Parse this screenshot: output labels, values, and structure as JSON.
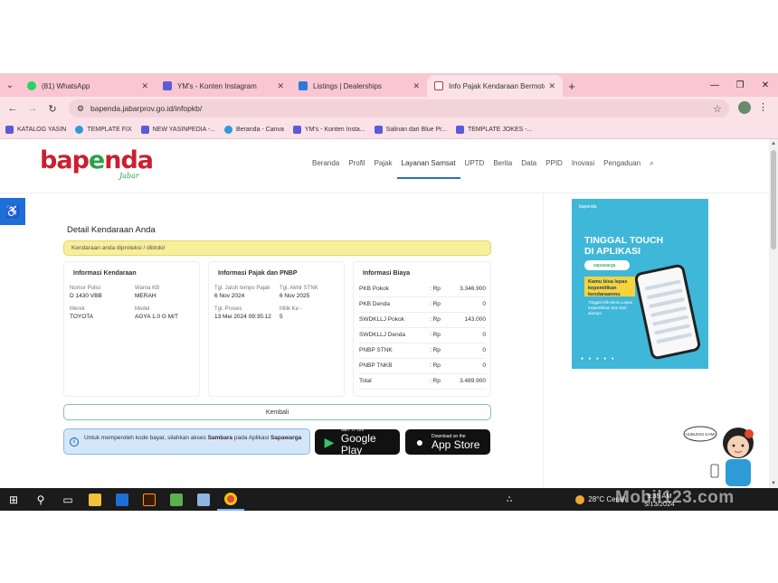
{
  "browser": {
    "tabs": [
      {
        "title": "(81) WhatsApp",
        "favicon_color": "#25d366"
      },
      {
        "title": "YM's - Konten Instagram",
        "favicon_color": "#5b5bd6"
      },
      {
        "title": "Listings | Dealerships",
        "favicon_color": "#2b79d6"
      },
      {
        "title": "Info Pajak Kendaraan Bermotor",
        "favicon_color": "#d03030"
      }
    ],
    "url": "bapenda.jabarprov.go.id/infopkb/",
    "bookmarks": [
      "KATALOG YASIN",
      "TEMPLATE FIX",
      "NEW YASINPEDIA -...",
      "Beranda - Canva",
      "YM's - Konten Insta...",
      "Salinan dari Blue Pr...",
      "TEMPLATE JOKES -..."
    ]
  },
  "site": {
    "logo_main": "bapenda",
    "logo_sub": "Jabar",
    "nav": [
      "Beranda",
      "Profil",
      "Pajak",
      "Layanan Samsat",
      "UPTD",
      "Berita",
      "Data",
      "PPID",
      "Inovasi",
      "Pengaduan"
    ],
    "nav_active": "Layanan Samsat"
  },
  "main": {
    "title": "Detail Kendaraan Anda",
    "notice": "Kendaraan anda diproteksi / diblokir",
    "vehicle": {
      "heading": "Informasi Kendaraan",
      "nopol_label": "Nomor Polisi",
      "nopol": "D 1430 VBB",
      "warna_label": "Warna KB",
      "warna": "MERAH",
      "merek_label": "Merek",
      "merek": "TOYOTA",
      "model_label": "Model",
      "model": "AGYA 1.0 G M/T"
    },
    "tax": {
      "heading": "Informasi Pajak dan PNBP",
      "jt_label": "Tgl. Jatuh tempo Pajak",
      "jt": "6 Nov 2024",
      "stnk_label": "Tgl. Akhir STNK",
      "stnk": "6 Nov 2025",
      "proses_label": "Tgl. Proses",
      "proses": "13 Mei 2024 09:35:12",
      "milik_label": "Milik Ke -",
      "milik": "5"
    },
    "costs": {
      "heading": "Informasi Biaya",
      "currency": ": Rp",
      "rows": [
        {
          "name": "PKB Pokok",
          "value": "3.346.900"
        },
        {
          "name": "PKB Denda",
          "value": "0"
        },
        {
          "name": "SWDKLLJ Pokok",
          "value": "143.000"
        },
        {
          "name": "SWDKLLJ Denda",
          "value": "0"
        },
        {
          "name": "PNBP STNK",
          "value": "0"
        },
        {
          "name": "PNBP TNKB",
          "value": "0"
        },
        {
          "name": "Total",
          "value": "3.489.900"
        }
      ]
    },
    "back_button": "Kembali",
    "info_text_1": "Untuk memperoleh kode bayar, silahkan akses ",
    "info_bold_1": "Sambara",
    "info_text_2": " pada Aplikasi ",
    "info_bold_2": "Sapawarga",
    "google_play_small": "GET IT ON",
    "google_play_big": "Google Play",
    "app_store_small": "Download on the",
    "app_store_big": "App Store"
  },
  "ad": {
    "brand": "bapenda",
    "headline_1": "TINGGAL TOUCH",
    "headline_2": "DI APLIKASI",
    "pill": "sapawarga",
    "ribbon": "Kamu bisa lepas kepemilikan kendaraanmu",
    "small": "Tinggal Klik Menu Lepas Kepemilikan dan ikuti alurnya"
  },
  "mascot_bubble": "HUBUNGI KAMI",
  "taskbar": {
    "weather": "28°C Cerah",
    "time": "9:35 AM",
    "date": "5/13/2024"
  },
  "watermark": "Mobil123.com",
  "colors": {
    "tab_strip": "#f9c6d2",
    "brand_red": "#cc1f2f",
    "brand_green": "#2aa24a",
    "notice_yellow": "#f7ef9a",
    "info_blue": "#d4e6f9"
  }
}
